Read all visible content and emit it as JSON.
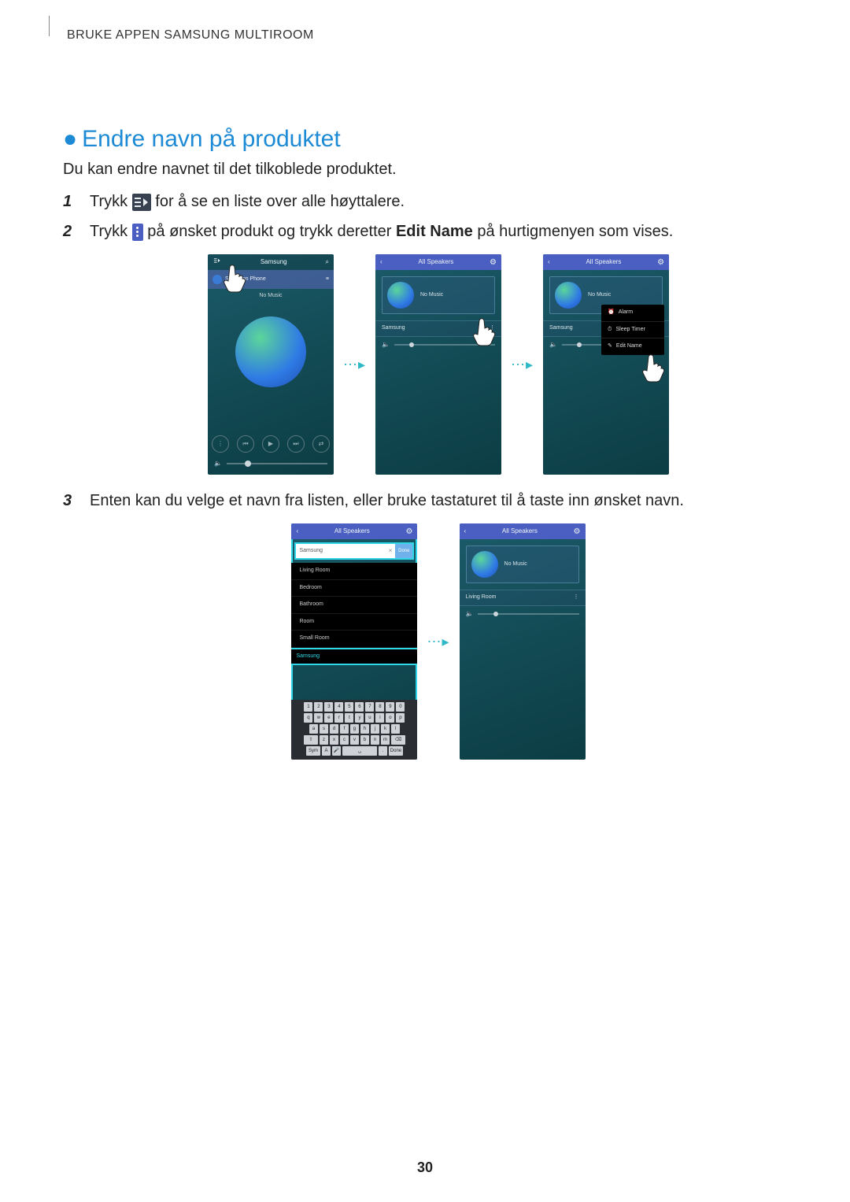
{
  "header_link": "BRUKE APPEN SAMSUNG MULTIROOM",
  "heading": "Endre navn på produktet",
  "intro": "Du kan endre navnet til det tilkoblede produktet.",
  "step1_a": "Trykk ",
  "step1_b": " for å se en liste over alle høyttalere.",
  "step2_a": "Trykk ",
  "step2_b": " på ønsket produkt og trykk deretter ",
  "step2_bold": "Edit Name",
  "step2_c": " på hurtigmenyen som vises.",
  "step3": "Enten kan du velge et navn fra listen, eller bruke tastaturet til å taste inn ønsket navn.",
  "page_number": "30",
  "screens": {
    "s1": {
      "title": "Samsung",
      "subtitle": "Songs on Phone",
      "now": "No Music"
    },
    "s2": {
      "title": "All Speakers",
      "card": "No Music",
      "speaker": "Samsung"
    },
    "s3": {
      "title": "All Speakers",
      "card": "No Music",
      "speaker": "Samsung",
      "menu": {
        "a": "Alarm",
        "b": "Sleep Timer",
        "c": "Edit Name"
      }
    },
    "s4": {
      "title": "All Speakers",
      "input": "Samsung",
      "done_btn": "Done",
      "list": [
        "Living Room",
        "Bedroom",
        "Bathroom",
        "Room",
        "Small Room"
      ],
      "kbd_input": "Samsung",
      "sym": "Sym",
      "kdone": "Done"
    },
    "s5": {
      "title": "All Speakers",
      "card": "No Music",
      "speaker": "Living Room"
    }
  }
}
